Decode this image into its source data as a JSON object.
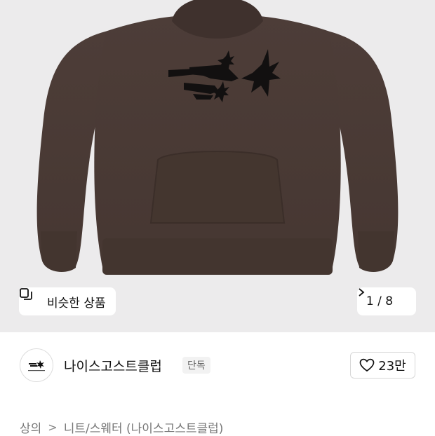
{
  "gallery": {
    "similar_label": "비슷한 상품",
    "page_indicator": "1 / 8",
    "background_color": "#ecebec",
    "product_color": "#4a3a35",
    "icons": {
      "similar": "similar-products-icon",
      "next": "chevron-right-icon"
    }
  },
  "brand": {
    "name": "나이스고스트클럽",
    "badge": "단독",
    "like_count": "23만",
    "icons": {
      "like": "heart-icon"
    }
  },
  "breadcrumb": {
    "items": [
      "상의",
      "니트/스웨터 (나이스고스트클럽)"
    ],
    "separator": ">"
  }
}
